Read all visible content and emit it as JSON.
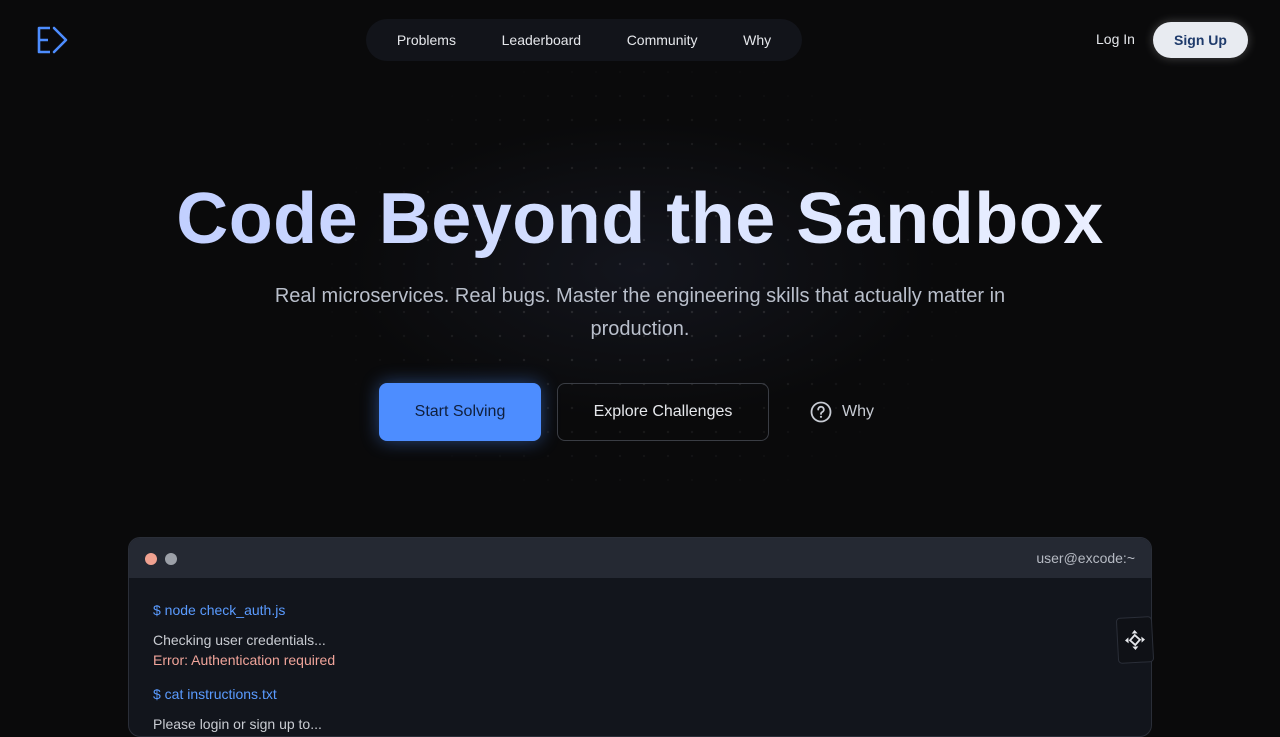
{
  "brand": {
    "logo_icon": "excode-logo-icon",
    "accent": "#4d8dff"
  },
  "nav": {
    "items": [
      {
        "label": "Problems"
      },
      {
        "label": "Leaderboard"
      },
      {
        "label": "Community"
      },
      {
        "label": "Why"
      }
    ]
  },
  "auth": {
    "login_label": "Log In",
    "signup_label": "Sign Up"
  },
  "hero": {
    "title": "Code Beyond the Sandbox",
    "subtitle": "Real microservices. Real bugs. Master the engineering skills that actually matter in production.",
    "primary_cta": "Start Solving",
    "secondary_cta": "Explore Challenges",
    "why_label": "Why",
    "why_icon": "question-circle-icon"
  },
  "terminal": {
    "title": "user@excode:~",
    "lines": [
      {
        "type": "cmd",
        "text": "$ node check_auth.js"
      },
      {
        "type": "out",
        "text": "Checking user credentials..."
      },
      {
        "type": "err",
        "text": "Error: Authentication required"
      },
      {
        "type": "cmd",
        "text": "$ cat instructions.txt"
      },
      {
        "type": "out",
        "text": "Please login or sign up to..."
      }
    ]
  },
  "floating_widget": {
    "icon": "move-arrows-icon"
  }
}
